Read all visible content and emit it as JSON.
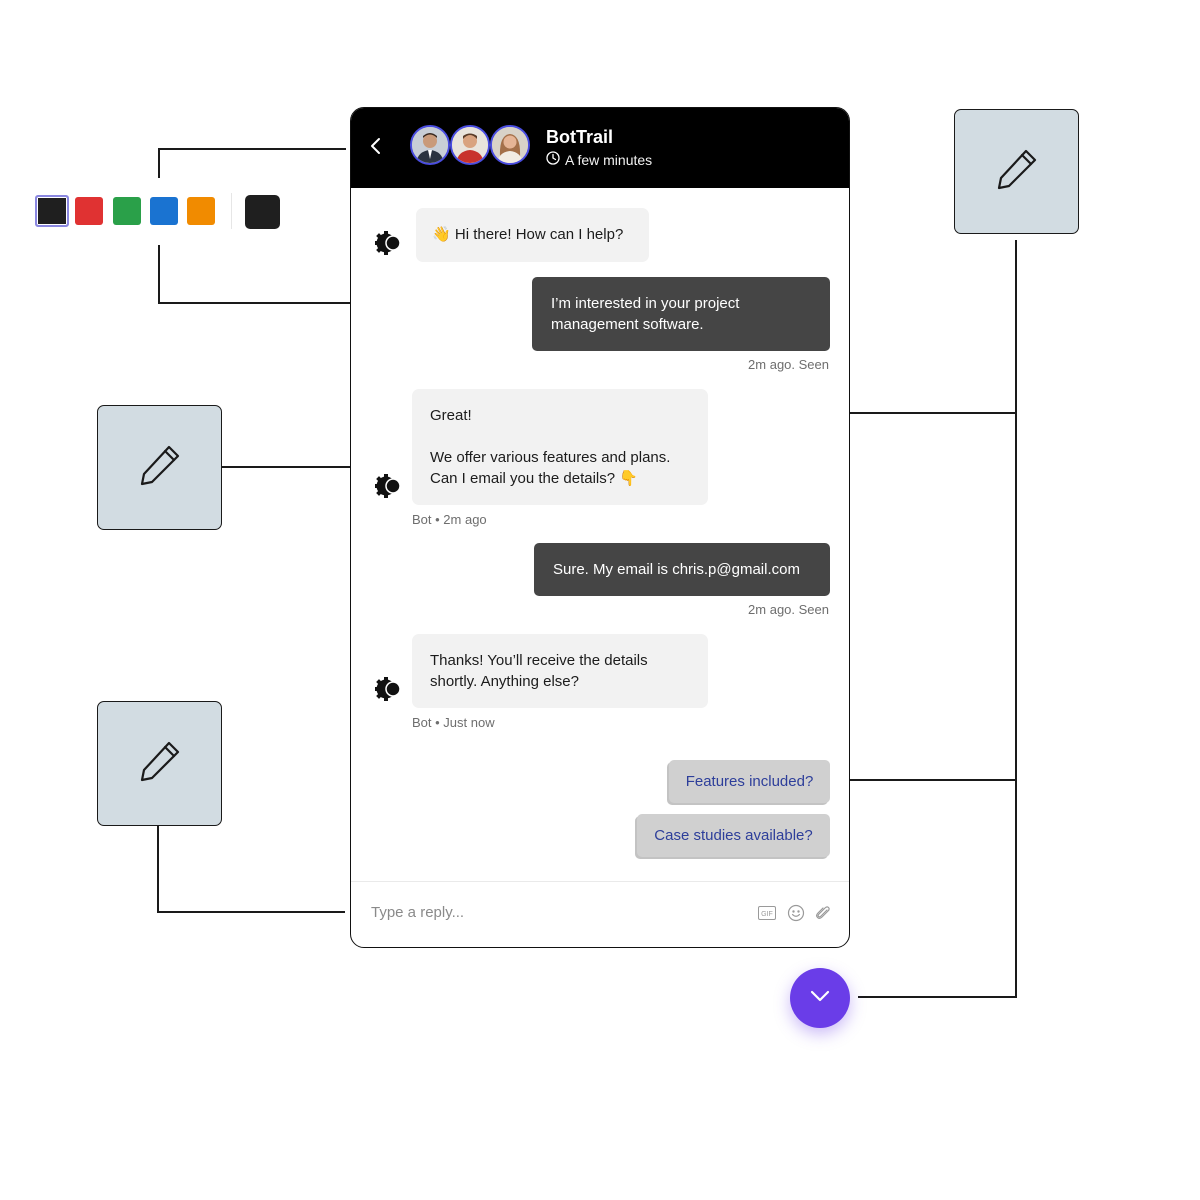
{
  "colors": {
    "accent": "#6a3de8",
    "header_bg": "#000000",
    "avatar_ring": "#4a4de0",
    "edit_box_bg": "#d2dce2",
    "user_bubble": "#454545",
    "bot_bubble": "#f2f2f2",
    "suggestion_bg": "#d0d0d0",
    "suggestion_text": "#2d3e9a"
  },
  "palette": {
    "swatches": [
      {
        "name": "black",
        "color": "#1f1f1f",
        "selected": true
      },
      {
        "name": "red",
        "color": "#e03232"
      },
      {
        "name": "green",
        "color": "#2aa049"
      },
      {
        "name": "blue",
        "color": "#1a73d1"
      },
      {
        "name": "orange",
        "color": "#f18b00"
      }
    ],
    "current": {
      "name": "black",
      "color": "#1f1f1f"
    }
  },
  "edit_boxes": [
    {
      "icon": "pencil-icon"
    },
    {
      "icon": "pencil-icon"
    },
    {
      "icon": "pencil-icon"
    }
  ],
  "chat": {
    "header": {
      "back_icon": "chevron-left-icon",
      "title": "BotTrail",
      "status_icon": "clock-icon",
      "status": "A few minutes",
      "avatars": [
        "avatar-man-suit",
        "avatar-man-red-shirt",
        "avatar-woman"
      ]
    },
    "messages": [
      {
        "from": "bot",
        "emoji": "👋",
        "text": "Hi there! How can I help?"
      },
      {
        "from": "user",
        "lines": [
          "I’m interested in your project",
          "management software."
        ],
        "meta": "2m ago. Seen"
      },
      {
        "from": "bot",
        "lines": [
          "Great!",
          "",
          "We offer various features and plans.",
          "Can I email you the details? 👇"
        ],
        "meta": "Bot • 2m ago"
      },
      {
        "from": "user",
        "text": "Sure. My email is chris.p@gmail.com",
        "meta": "2m ago. Seen"
      },
      {
        "from": "bot",
        "lines": [
          "Thanks! You’ll receive the details",
          "shortly. Anything else?"
        ],
        "meta": "Bot • Just now"
      }
    ],
    "suggestions": [
      "Features included?",
      "Case studies available?"
    ],
    "composer": {
      "placeholder": "Type a reply...",
      "tools": [
        "gif-icon",
        "emoji-icon",
        "paperclip-icon"
      ]
    }
  },
  "fab": {
    "icon": "chevron-down-icon"
  }
}
